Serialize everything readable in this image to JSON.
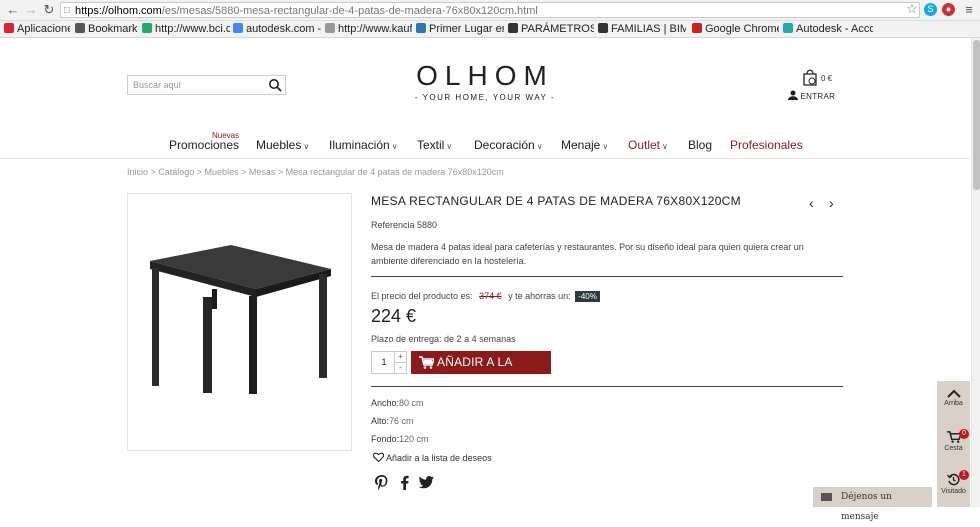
{
  "browser": {
    "url_host": "https://olhom.com",
    "url_path": "/es/mesas/5880-mesa-rectangular-de-4-patas-de-madera-76x80x120cm.html",
    "bookmarks": [
      {
        "label": "Aplicaciones",
        "icon": "apps-grid-icon",
        "color": "#d23"
      },
      {
        "label": "Bookmarks",
        "icon": "star-icon",
        "color": "#555"
      },
      {
        "label": "http://www.bci.cl",
        "icon": "bci-icon",
        "color": "#2a6"
      },
      {
        "label": "autodesk.com -",
        "icon": "google-icon",
        "color": "#4285f4"
      },
      {
        "label": "http://www.kaufmann.c",
        "icon": "page-icon",
        "color": "#999"
      },
      {
        "label": "Primer Lugar en",
        "icon": "page-icon",
        "color": "#37a"
      },
      {
        "label": "PARÁMETROS EN",
        "icon": "page-icon",
        "color": "#333"
      },
      {
        "label": "FAMILIAS | BIMCH",
        "icon": "page-icon",
        "color": "#333"
      },
      {
        "label": "Google Chrome -",
        "icon": "google-icon",
        "color": "#c22"
      },
      {
        "label": "Autodesk - Acco",
        "icon": "autodesk-icon",
        "color": "#2aa"
      }
    ]
  },
  "header": {
    "search_placeholder": "Buscar aquí",
    "logo": "OLHOM",
    "tagline": "- YOUR HOME, YOUR WAY -",
    "cart_amount": "0 €",
    "login": "ENTRAR"
  },
  "menu": {
    "new_tag": "Nuevas",
    "items": [
      {
        "label": "Promociones",
        "caret": false,
        "color": "#222"
      },
      {
        "label": "Muebles",
        "caret": true,
        "color": "#222"
      },
      {
        "label": "Iluminación",
        "caret": true,
        "color": "#222"
      },
      {
        "label": "Textil",
        "caret": true,
        "color": "#222"
      },
      {
        "label": "Decoración",
        "caret": true,
        "color": "#222"
      },
      {
        "label": "Menaje",
        "caret": true,
        "color": "#222"
      },
      {
        "label": "Outlet",
        "caret": true,
        "color": "#8b1a1a"
      },
      {
        "label": "Blog",
        "caret": false,
        "color": "#222"
      },
      {
        "label": "Profesionales",
        "caret": false,
        "color": "#8b1a1a"
      }
    ]
  },
  "breadcrumb": "Inicio > Catálogo > Muebles > Mesas > Mesa rectangular de 4 patas de madera 76x80x120cm",
  "product": {
    "title": "MESA RECTANGULAR DE 4 PATAS DE MADERA 76X80X120CM",
    "reference": "Referencia 5880",
    "description": "Mesa de madera 4 patas ideal para cafeterías y restaurantes. Por su diseño ideal para quien quiera crear un ambiente diferenciado en la hostelería.",
    "price_label": "El precio del producto es:",
    "old_price": "374 €",
    "savings_label": "y te ahorras un:",
    "discount": "-40%",
    "price": "224 €",
    "delivery": "Plazo de entrega: de 2 a 4 semanas",
    "quantity": "1",
    "add_to_cart": "AÑADIR A LA CESTA",
    "specs": [
      {
        "label": "Ancho:",
        "value": "80 cm"
      },
      {
        "label": "Alto:",
        "value": "76 cm"
      },
      {
        "label": "Fondo:",
        "value": "120 cm"
      }
    ],
    "wishlist": "Añadir a la lista de deseos"
  },
  "side_panel": {
    "top_label": "Arriba",
    "cart_label": "Cesta",
    "cart_count": "0",
    "visited_label": "Visitado",
    "visited_count": "1"
  },
  "message_tab": "Déjenos un mensaje",
  "colors": {
    "accent": "#8b1a1a",
    "discount_bg": "#2e3a40",
    "side_panel": "#d9d1c7"
  }
}
